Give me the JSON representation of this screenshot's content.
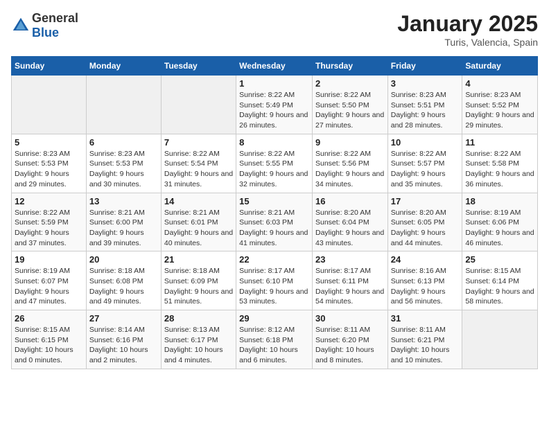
{
  "header": {
    "logo_general": "General",
    "logo_blue": "Blue",
    "month": "January 2025",
    "location": "Turis, Valencia, Spain"
  },
  "days_of_week": [
    "Sunday",
    "Monday",
    "Tuesday",
    "Wednesday",
    "Thursday",
    "Friday",
    "Saturday"
  ],
  "weeks": [
    [
      {
        "day": "",
        "sunrise": "",
        "sunset": "",
        "daylight": "",
        "empty": true
      },
      {
        "day": "",
        "sunrise": "",
        "sunset": "",
        "daylight": "",
        "empty": true
      },
      {
        "day": "",
        "sunrise": "",
        "sunset": "",
        "daylight": "",
        "empty": true
      },
      {
        "day": "1",
        "sunrise": "Sunrise: 8:22 AM",
        "sunset": "Sunset: 5:49 PM",
        "daylight": "Daylight: 9 hours and 26 minutes."
      },
      {
        "day": "2",
        "sunrise": "Sunrise: 8:22 AM",
        "sunset": "Sunset: 5:50 PM",
        "daylight": "Daylight: 9 hours and 27 minutes."
      },
      {
        "day": "3",
        "sunrise": "Sunrise: 8:23 AM",
        "sunset": "Sunset: 5:51 PM",
        "daylight": "Daylight: 9 hours and 28 minutes."
      },
      {
        "day": "4",
        "sunrise": "Sunrise: 8:23 AM",
        "sunset": "Sunset: 5:52 PM",
        "daylight": "Daylight: 9 hours and 29 minutes."
      }
    ],
    [
      {
        "day": "5",
        "sunrise": "Sunrise: 8:23 AM",
        "sunset": "Sunset: 5:53 PM",
        "daylight": "Daylight: 9 hours and 29 minutes."
      },
      {
        "day": "6",
        "sunrise": "Sunrise: 8:23 AM",
        "sunset": "Sunset: 5:53 PM",
        "daylight": "Daylight: 9 hours and 30 minutes."
      },
      {
        "day": "7",
        "sunrise": "Sunrise: 8:22 AM",
        "sunset": "Sunset: 5:54 PM",
        "daylight": "Daylight: 9 hours and 31 minutes."
      },
      {
        "day": "8",
        "sunrise": "Sunrise: 8:22 AM",
        "sunset": "Sunset: 5:55 PM",
        "daylight": "Daylight: 9 hours and 32 minutes."
      },
      {
        "day": "9",
        "sunrise": "Sunrise: 8:22 AM",
        "sunset": "Sunset: 5:56 PM",
        "daylight": "Daylight: 9 hours and 34 minutes."
      },
      {
        "day": "10",
        "sunrise": "Sunrise: 8:22 AM",
        "sunset": "Sunset: 5:57 PM",
        "daylight": "Daylight: 9 hours and 35 minutes."
      },
      {
        "day": "11",
        "sunrise": "Sunrise: 8:22 AM",
        "sunset": "Sunset: 5:58 PM",
        "daylight": "Daylight: 9 hours and 36 minutes."
      }
    ],
    [
      {
        "day": "12",
        "sunrise": "Sunrise: 8:22 AM",
        "sunset": "Sunset: 5:59 PM",
        "daylight": "Daylight: 9 hours and 37 minutes."
      },
      {
        "day": "13",
        "sunrise": "Sunrise: 8:21 AM",
        "sunset": "Sunset: 6:00 PM",
        "daylight": "Daylight: 9 hours and 39 minutes."
      },
      {
        "day": "14",
        "sunrise": "Sunrise: 8:21 AM",
        "sunset": "Sunset: 6:01 PM",
        "daylight": "Daylight: 9 hours and 40 minutes."
      },
      {
        "day": "15",
        "sunrise": "Sunrise: 8:21 AM",
        "sunset": "Sunset: 6:03 PM",
        "daylight": "Daylight: 9 hours and 41 minutes."
      },
      {
        "day": "16",
        "sunrise": "Sunrise: 8:20 AM",
        "sunset": "Sunset: 6:04 PM",
        "daylight": "Daylight: 9 hours and 43 minutes."
      },
      {
        "day": "17",
        "sunrise": "Sunrise: 8:20 AM",
        "sunset": "Sunset: 6:05 PM",
        "daylight": "Daylight: 9 hours and 44 minutes."
      },
      {
        "day": "18",
        "sunrise": "Sunrise: 8:19 AM",
        "sunset": "Sunset: 6:06 PM",
        "daylight": "Daylight: 9 hours and 46 minutes."
      }
    ],
    [
      {
        "day": "19",
        "sunrise": "Sunrise: 8:19 AM",
        "sunset": "Sunset: 6:07 PM",
        "daylight": "Daylight: 9 hours and 47 minutes."
      },
      {
        "day": "20",
        "sunrise": "Sunrise: 8:18 AM",
        "sunset": "Sunset: 6:08 PM",
        "daylight": "Daylight: 9 hours and 49 minutes."
      },
      {
        "day": "21",
        "sunrise": "Sunrise: 8:18 AM",
        "sunset": "Sunset: 6:09 PM",
        "daylight": "Daylight: 9 hours and 51 minutes."
      },
      {
        "day": "22",
        "sunrise": "Sunrise: 8:17 AM",
        "sunset": "Sunset: 6:10 PM",
        "daylight": "Daylight: 9 hours and 53 minutes."
      },
      {
        "day": "23",
        "sunrise": "Sunrise: 8:17 AM",
        "sunset": "Sunset: 6:11 PM",
        "daylight": "Daylight: 9 hours and 54 minutes."
      },
      {
        "day": "24",
        "sunrise": "Sunrise: 8:16 AM",
        "sunset": "Sunset: 6:13 PM",
        "daylight": "Daylight: 9 hours and 56 minutes."
      },
      {
        "day": "25",
        "sunrise": "Sunrise: 8:15 AM",
        "sunset": "Sunset: 6:14 PM",
        "daylight": "Daylight: 9 hours and 58 minutes."
      }
    ],
    [
      {
        "day": "26",
        "sunrise": "Sunrise: 8:15 AM",
        "sunset": "Sunset: 6:15 PM",
        "daylight": "Daylight: 10 hours and 0 minutes."
      },
      {
        "day": "27",
        "sunrise": "Sunrise: 8:14 AM",
        "sunset": "Sunset: 6:16 PM",
        "daylight": "Daylight: 10 hours and 2 minutes."
      },
      {
        "day": "28",
        "sunrise": "Sunrise: 8:13 AM",
        "sunset": "Sunset: 6:17 PM",
        "daylight": "Daylight: 10 hours and 4 minutes."
      },
      {
        "day": "29",
        "sunrise": "Sunrise: 8:12 AM",
        "sunset": "Sunset: 6:18 PM",
        "daylight": "Daylight: 10 hours and 6 minutes."
      },
      {
        "day": "30",
        "sunrise": "Sunrise: 8:11 AM",
        "sunset": "Sunset: 6:20 PM",
        "daylight": "Daylight: 10 hours and 8 minutes."
      },
      {
        "day": "31",
        "sunrise": "Sunrise: 8:11 AM",
        "sunset": "Sunset: 6:21 PM",
        "daylight": "Daylight: 10 hours and 10 minutes."
      },
      {
        "day": "",
        "sunrise": "",
        "sunset": "",
        "daylight": "",
        "empty": true
      }
    ]
  ]
}
